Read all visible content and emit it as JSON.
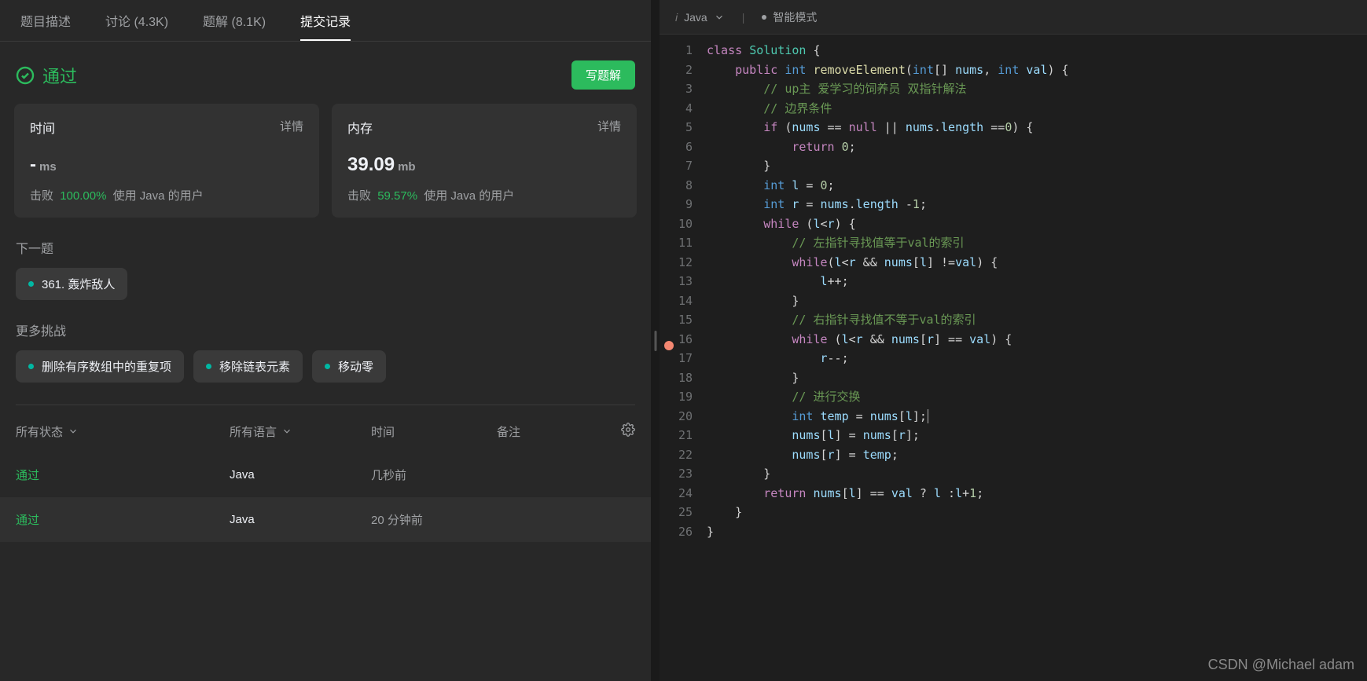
{
  "tabs": [
    {
      "label": "题目描述"
    },
    {
      "label": "讨论 (4.3K)"
    },
    {
      "label": "题解 (8.1K)"
    },
    {
      "label": "提交记录"
    }
  ],
  "activeTab": 3,
  "status": {
    "label": "通过"
  },
  "writeSolutionBtn": "写题解",
  "stats": {
    "time": {
      "title": "时间",
      "details": "详情",
      "value": "-",
      "unit": "ms",
      "beatLabel": "击败",
      "beatPct": "100.00%",
      "beatSuffix": "使用 Java 的用户"
    },
    "memory": {
      "title": "内存",
      "details": "详情",
      "value": "39.09",
      "unit": "mb",
      "beatLabel": "击败",
      "beatPct": "59.57%",
      "beatSuffix": "使用 Java 的用户"
    }
  },
  "nextTitle": "下一题",
  "nextProblem": "361. 轰炸敌人",
  "moreTitle": "更多挑战",
  "challenges": [
    "删除有序数组中的重复项",
    "移除链表元素",
    "移动零"
  ],
  "submissions": {
    "filters": {
      "status": "所有状态",
      "lang": "所有语言",
      "time": "时间",
      "note": "备注"
    },
    "rows": [
      {
        "status": "通过",
        "lang": "Java",
        "time": "几秒前",
        "note": ""
      },
      {
        "status": "通过",
        "lang": "Java",
        "time": "20 分钟前",
        "note": ""
      }
    ]
  },
  "editor": {
    "language": "Java",
    "mode": "智能模式",
    "breakpointLine": 16,
    "cursorLine": 20,
    "lines": [
      [
        [
          "k",
          "class"
        ],
        [
          " "
        ],
        [
          "cls",
          "Solution"
        ],
        [
          " {"
        ]
      ],
      [
        [
          "    "
        ],
        [
          "k",
          "public"
        ],
        [
          " "
        ],
        [
          "t",
          "int"
        ],
        [
          " "
        ],
        [
          "fn",
          "removeElement"
        ],
        [
          "("
        ],
        [
          "t",
          "int"
        ],
        [
          "[] "
        ],
        [
          "id",
          "nums"
        ],
        [
          ", "
        ],
        [
          "t",
          "int"
        ],
        [
          " "
        ],
        [
          "id",
          "val"
        ],
        [
          ") {"
        ]
      ],
      [
        [
          "        "
        ],
        [
          "c",
          "// up主 爱学习的饲养员 双指针解法"
        ]
      ],
      [
        [
          "        "
        ],
        [
          "c",
          "// 边界条件"
        ]
      ],
      [
        [
          "        "
        ],
        [
          "k",
          "if"
        ],
        [
          " ("
        ],
        [
          "id",
          "nums"
        ],
        [
          " == "
        ],
        [
          "k",
          "null"
        ],
        [
          " || "
        ],
        [
          "id",
          "nums"
        ],
        [
          "."
        ],
        [
          "id",
          "length"
        ],
        [
          " =="
        ],
        [
          "n",
          "0"
        ],
        [
          ") {"
        ]
      ],
      [
        [
          "            "
        ],
        [
          "k",
          "return"
        ],
        [
          " "
        ],
        [
          "n",
          "0"
        ],
        [
          ";"
        ]
      ],
      [
        [
          "        }"
        ]
      ],
      [
        [
          "        "
        ],
        [
          "t",
          "int"
        ],
        [
          " "
        ],
        [
          "id",
          "l"
        ],
        [
          " = "
        ],
        [
          "n",
          "0"
        ],
        [
          ";"
        ]
      ],
      [
        [
          "        "
        ],
        [
          "t",
          "int"
        ],
        [
          " "
        ],
        [
          "id",
          "r"
        ],
        [
          " = "
        ],
        [
          "id",
          "nums"
        ],
        [
          "."
        ],
        [
          "id",
          "length"
        ],
        [
          " -"
        ],
        [
          "n",
          "1"
        ],
        [
          ";"
        ]
      ],
      [
        [
          "        "
        ],
        [
          "k",
          "while"
        ],
        [
          " ("
        ],
        [
          "id",
          "l"
        ],
        [
          "<"
        ],
        [
          "id",
          "r"
        ],
        [
          ") {"
        ]
      ],
      [
        [
          "            "
        ],
        [
          "c",
          "// 左指针寻找值等于val的索引"
        ]
      ],
      [
        [
          "            "
        ],
        [
          "k",
          "while"
        ],
        [
          "("
        ],
        [
          "id",
          "l"
        ],
        [
          "<"
        ],
        [
          "id",
          "r"
        ],
        [
          " && "
        ],
        [
          "id",
          "nums"
        ],
        [
          "["
        ],
        [
          "id",
          "l"
        ],
        [
          "] !="
        ],
        [
          "id",
          "val"
        ],
        [
          ") {"
        ]
      ],
      [
        [
          "                "
        ],
        [
          "id",
          "l"
        ],
        [
          "++;"
        ]
      ],
      [
        [
          "            }"
        ]
      ],
      [
        [
          "            "
        ],
        [
          "c",
          "// 右指针寻找值不等于val的索引"
        ]
      ],
      [
        [
          "            "
        ],
        [
          "k",
          "while"
        ],
        [
          " ("
        ],
        [
          "id",
          "l"
        ],
        [
          "<"
        ],
        [
          "id",
          "r"
        ],
        [
          " && "
        ],
        [
          "id",
          "nums"
        ],
        [
          "["
        ],
        [
          "id",
          "r"
        ],
        [
          "] == "
        ],
        [
          "id",
          "val"
        ],
        [
          ") {"
        ]
      ],
      [
        [
          "                "
        ],
        [
          "id",
          "r"
        ],
        [
          "--;"
        ]
      ],
      [
        [
          "            }"
        ]
      ],
      [
        [
          "            "
        ],
        [
          "c",
          "// 进行交换"
        ]
      ],
      [
        [
          "            "
        ],
        [
          "t",
          "int"
        ],
        [
          " "
        ],
        [
          "id",
          "temp"
        ],
        [
          " = "
        ],
        [
          "id",
          "nums"
        ],
        [
          "["
        ],
        [
          "id",
          "l"
        ],
        [
          "];"
        ]
      ],
      [
        [
          "            "
        ],
        [
          "id",
          "nums"
        ],
        [
          "["
        ],
        [
          "id",
          "l"
        ],
        [
          "] = "
        ],
        [
          "id",
          "nums"
        ],
        [
          "["
        ],
        [
          "id",
          "r"
        ],
        [
          "];"
        ]
      ],
      [
        [
          "            "
        ],
        [
          "id",
          "nums"
        ],
        [
          "["
        ],
        [
          "id",
          "r"
        ],
        [
          "] = "
        ],
        [
          "id",
          "temp"
        ],
        [
          ";"
        ]
      ],
      [
        [
          "        }"
        ]
      ],
      [
        [
          "        "
        ],
        [
          "k",
          "return"
        ],
        [
          " "
        ],
        [
          "id",
          "nums"
        ],
        [
          "["
        ],
        [
          "id",
          "l"
        ],
        [
          "] == "
        ],
        [
          "id",
          "val"
        ],
        [
          " ? "
        ],
        [
          "id",
          "l"
        ],
        [
          " :"
        ],
        [
          "id",
          "l"
        ],
        [
          "+"
        ],
        [
          "n",
          "1"
        ],
        [
          ";"
        ]
      ],
      [
        [
          "    }"
        ]
      ],
      [
        [
          "}"
        ]
      ]
    ]
  },
  "watermark": "CSDN @Michael adam"
}
